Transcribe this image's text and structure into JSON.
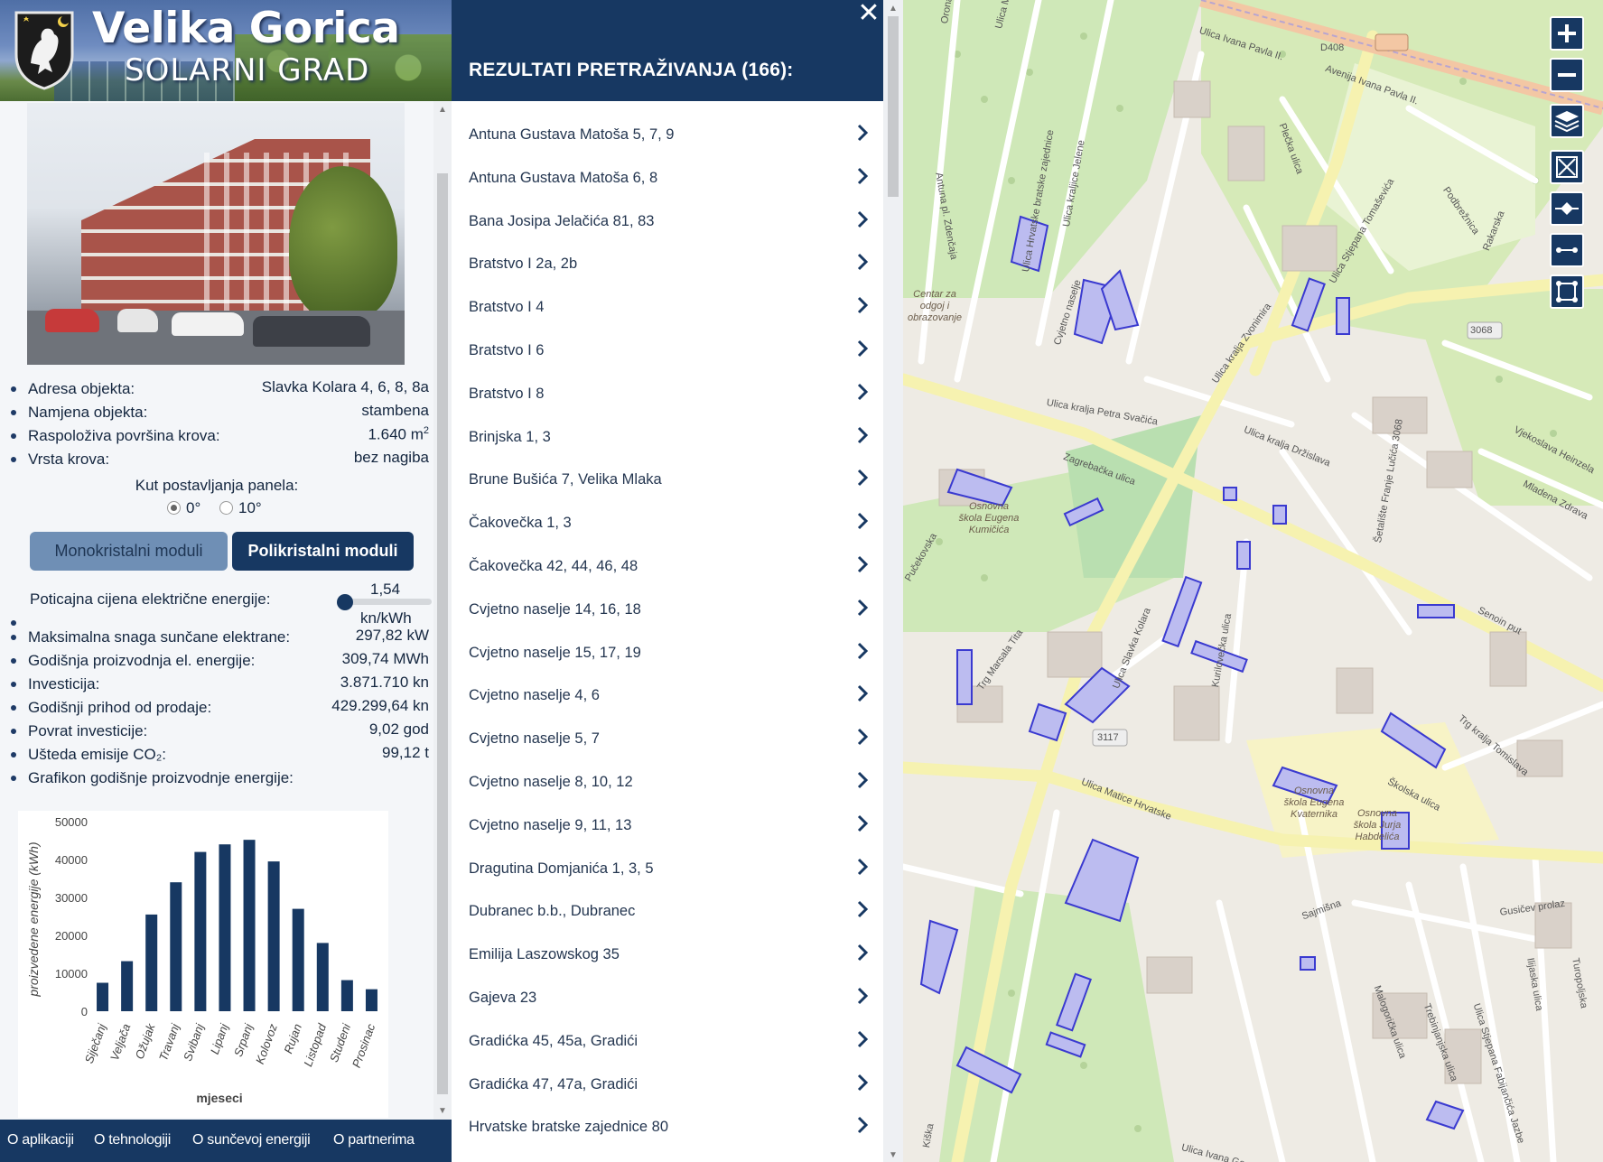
{
  "header": {
    "title_line1": "Velika Gorica",
    "title_line2": "SOLARNI GRAD"
  },
  "building": {
    "address_label": "Adresa objekta:",
    "address_value": "Slavka Kolara 4, 6, 8, 8a",
    "purpose_label": "Namjena objekta:",
    "purpose_value": "stambena",
    "roof_area_label": "Raspoloživa površina krova:",
    "roof_area_value": "1.640 m",
    "roof_area_sup": "2",
    "roof_type_label": "Vrsta krova:",
    "roof_type_value": "bez nagiba"
  },
  "panel_angle": {
    "label": "Kut postavljanja panela:",
    "options": [
      "0°",
      "10°"
    ],
    "selected": "0°"
  },
  "module_buttons": {
    "mono": "Monokristalni moduli",
    "poly": "Polikristalni moduli",
    "active": "poly"
  },
  "incentive": {
    "label": "Poticajna cijena električne energije:",
    "value": "1,54",
    "unit": "kn/kWh",
    "slider_fraction": 0.0
  },
  "results_info": [
    {
      "label": "Maksimalna snaga sunčane elektrane:",
      "value": "297,82 kW"
    },
    {
      "label": "Godišnja proizvodnja el. energije:",
      "value": "309,74 MWh"
    },
    {
      "label": "Investicija:",
      "value": "3.871.710 kn"
    },
    {
      "label": "Godišnji prihod od prodaje:",
      "value": "429.299,64 kn"
    },
    {
      "label": "Povrat investicije:",
      "value": "9,02 god"
    },
    {
      "label": "Ušteda emisije CO₂:",
      "value": "99,12 t"
    },
    {
      "label": "Grafikon godišnje proizvodnje energije:",
      "value": ""
    }
  ],
  "chart_data": {
    "type": "bar",
    "categories": [
      "Siječanj",
      "Veljača",
      "Ožujak",
      "Travanj",
      "Svibanj",
      "Lipanj",
      "Srpanj",
      "Kolovoz",
      "Rujan",
      "Listopad",
      "Studeni",
      "Prosinac"
    ],
    "values": [
      7500,
      13200,
      25500,
      34000,
      42000,
      44000,
      45200,
      39500,
      27000,
      18000,
      8200,
      5800
    ],
    "xlabel": "mjeseci",
    "ylabel": "proizvedene energije (kWh)",
    "ylim": [
      0,
      50000
    ],
    "yticks": [
      0,
      10000,
      20000,
      30000,
      40000,
      50000
    ],
    "bar_color": "#173862",
    "grid": false
  },
  "footer": {
    "links": [
      "O aplikaciji",
      "O tehnologiji",
      "O sunčevoj energiji",
      "O partnerima"
    ]
  },
  "search_results": {
    "title": "REZULTATI PRETRAŽIVANJA (166):",
    "items": [
      "Antuna Gustava Matoša 5, 7, 9",
      "Antuna Gustava Matoša 6, 8",
      "Bana Josipa Jelačića 81, 83",
      "Bratstvo I 2a, 2b",
      "Bratstvo I 4",
      "Bratstvo I 6",
      "Bratstvo I 8",
      "Brinjska 1, 3",
      "Brune Bušića 7, Velika Mlaka",
      "Čakovečka 1, 3",
      "Čakovečka 42, 44, 46, 48",
      "Cvjetno naselje 14, 16, 18",
      "Cvjetno naselje 15, 17, 19",
      "Cvjetno naselje 4, 6",
      "Cvjetno naselje 5, 7",
      "Cvjetno naselje 8, 10, 12",
      "Cvjetno naselje 9, 11, 13",
      "Dragutina Domjanića 1, 3, 5",
      "Dubranec b.b., Dubranec",
      "Emilija Laszowskog 35",
      "Gajeva 23",
      "Gradićka 45, 45a, Gradići",
      "Gradićka 47, 47a, Gradići",
      "Hrvatske bratske zajednice 80"
    ]
  },
  "map": {
    "road_labels": [
      "Avenija Ivana Pavla II.",
      "Ulica Ivana Pavla II.",
      "D408",
      "3068",
      "3117",
      "Zagrebačka ulica",
      "Ulica kralja Zvonimira",
      "Ulica kralja Petra Svačića",
      "Ulica Slavka Kolara",
      "Ulica Matice Hrvatske",
      "Ulica kralja Držislava",
      "Trg kralja Tomislava",
      "Školska ulica",
      "Kurilovečka ulica",
      "Trg Marsala Tita",
      "Cvjetno naselje",
      "Ulica Hrvatske bratske zajednice",
      "Ulica kraljice Jelene",
      "Plečka ulica",
      "Podbrežnica",
      "Rakarska",
      "Vjekoslava Heinzela",
      "Mladena Zdrava",
      "Senoin put",
      "Sajmišna",
      "Gusičev prolaz",
      "Malogorička ulica",
      "Trebinjanjska ulica",
      "Ulica Stjepana Fabijančića Jazbe",
      "Ilijaska ulica",
      "Turopoljska",
      "Ulica Ivana Gorana",
      "Orona Župa",
      "Ulica Mate Lj.",
      "Antuna pl. Zdenčaja",
      "Šetalište Franje Lučića 3068",
      "Pučekovska",
      "Kiška",
      "Ulica Stjepana Tomaševića"
    ],
    "place_labels": [
      "Centar za odgoj i obrazovanje",
      "Osnovna škola Eugena Kumičića",
      "Osnovna škola Eugena Kvaternika",
      "Osnovna škola Jurja Habdelića"
    ],
    "zoom_controls": [
      "zoom-in",
      "zoom-out"
    ]
  }
}
